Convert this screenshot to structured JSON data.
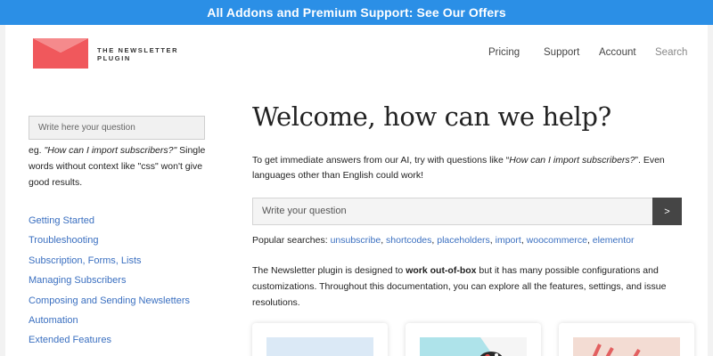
{
  "banner": {
    "text": "All Addons and Premium Support: See Our Offers"
  },
  "header": {
    "brand_line1": "THE NEWSLETTER",
    "brand_line2": "PLUGIN",
    "nav": [
      "Pricing",
      "Support",
      "Account",
      "Search"
    ]
  },
  "sidebar": {
    "search_placeholder": "Write here your question",
    "hint_prefix": "eg. ",
    "hint_example": "\"How can I import subscribers?\"",
    "hint_suffix": " Single words without context like \"css\" won't give good results.",
    "links": [
      "Getting Started",
      "Troubleshooting",
      "Subscription, Forms, Lists",
      "Managing Subscribers",
      "Composing and Sending Newsletters",
      "Automation",
      "Extended Features"
    ]
  },
  "main": {
    "title": "Welcome, how can we help?",
    "intro_prefix": "To get immediate answers from our AI, try with questions like “",
    "intro_example": "How can I import subscribers?",
    "intro_suffix": "”. Even languages other than English could work!",
    "search_placeholder": "Write your question",
    "search_button": ">",
    "popular_label": "Popular searches: ",
    "popular": [
      "unsubscribe",
      "shortcodes",
      "placeholders",
      "import",
      "woocommerce",
      "elementor"
    ],
    "desc_prefix": "The Newsletter plugin is designed to ",
    "desc_bold": "work out-of-box",
    "desc_suffix": " but it has many possible configurations and customizations. Throughout this documentation, you can explore all the features, settings, and issue resolutions."
  },
  "colors": {
    "banner": "#2b8fe6",
    "logo": "#f0585c",
    "link": "#3a6fc0",
    "button": "#454545"
  }
}
